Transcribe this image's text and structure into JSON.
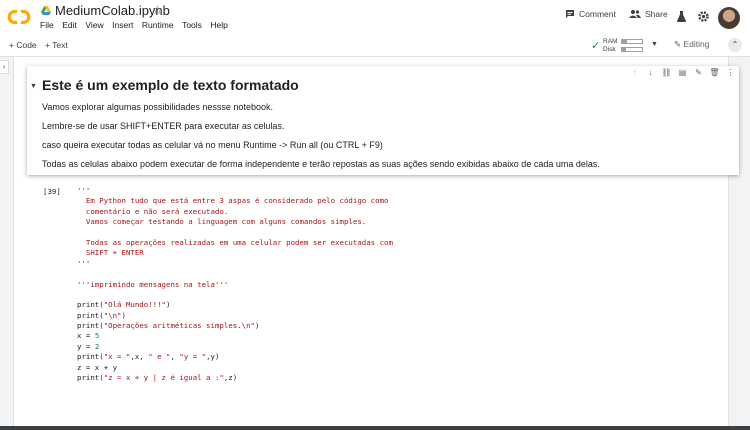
{
  "app": {
    "notebook_title": "MediumColab.ipynb",
    "menu": [
      "File",
      "Edit",
      "View",
      "Insert",
      "Runtime",
      "Tools",
      "Help"
    ],
    "comment_label": "Comment",
    "share_label": "Share"
  },
  "toolbar": {
    "add_code_label": "+ Code",
    "add_text_label": "+ Text",
    "ram_label": "RAM",
    "disk_label": "Disk",
    "ram_usage": 0.25,
    "disk_usage": 0.2,
    "editing_label": "Editing"
  },
  "text_cell": {
    "heading": "Este é um exemplo de texto formatado",
    "paragraphs": [
      "Vamos explorar algumas possibilidades nessse notebook.",
      "Lembre-se de usar SHIFT+ENTER para executar as celulas.",
      "caso queira executar todas as celular vá no menu Runtime -> Run all (ou CTRL + F9)",
      "Todas as celulas abaixo podem executar de forma independente e terão repostas as suas ações sendo exibidas abaixo de cada uma delas."
    ]
  },
  "code_cell": {
    "execution_count": "[39]",
    "lines": [
      "'''",
      "  Em Python tudo que está entre 3 aspas é considerado pelo código como",
      "  comentário e não será executado.",
      "  Vamos começar testando a linguagem com alguns comandos simples.",
      "",
      "  Todas as operações realizadas em uma celular podem ser executadas com",
      "  SHIFT + ENTER",
      "'''",
      "",
      "'''imprimindo mensagens na tela'''",
      "",
      "print(\"Olá Mundo!!!\")",
      "print(\"\\n\")",
      "print(\"Operações aritméticas simples.\\n\")",
      "x = 5",
      "y = 2",
      "print(\"x = \",x, \" e \", \"y = \",y)",
      "z = x + y",
      "print(\"z = x + y | z é igual a :\",z)"
    ]
  },
  "colors": {
    "accent_orange": "#f9ab00",
    "string_red": "#a31515",
    "number_green": "#098658",
    "check_green": "#188038"
  }
}
